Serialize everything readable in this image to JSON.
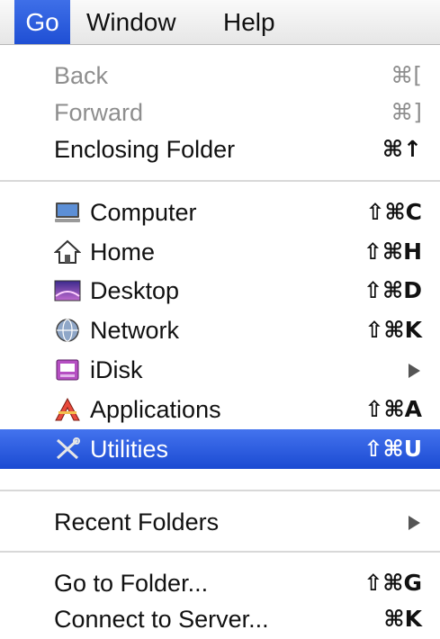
{
  "menubar": {
    "go": "Go",
    "window": "Window",
    "help": "Help"
  },
  "menu": {
    "back": {
      "label": "Back",
      "shortcut": "⌘["
    },
    "forward": {
      "label": "Forward",
      "shortcut": "⌘]"
    },
    "enclosing": {
      "label": "Enclosing Folder",
      "shortcut": "⌘↑"
    },
    "computer": {
      "label": "Computer",
      "shortcut": "⇧⌘C",
      "icon": "computer-icon"
    },
    "home": {
      "label": "Home",
      "shortcut": "⇧⌘H",
      "icon": "home-icon"
    },
    "desktop": {
      "label": "Desktop",
      "shortcut": "⇧⌘D",
      "icon": "desktop-icon"
    },
    "network": {
      "label": "Network",
      "shortcut": "⇧⌘K",
      "icon": "network-icon"
    },
    "idisk": {
      "label": "iDisk",
      "icon": "idisk-icon"
    },
    "applications": {
      "label": "Applications",
      "shortcut": "⇧⌘A",
      "icon": "applications-icon"
    },
    "utilities": {
      "label": "Utilities",
      "shortcut": "⇧⌘U",
      "icon": "utilities-icon"
    },
    "recent": {
      "label": "Recent Folders"
    },
    "goto": {
      "label": "Go to Folder...",
      "shortcut": "⇧⌘G"
    },
    "connect": {
      "label": "Connect to Server...",
      "shortcut": "⌘K"
    }
  },
  "colors": {
    "selection": "#2a5adf",
    "disabled_text": "#8e8e8e"
  }
}
